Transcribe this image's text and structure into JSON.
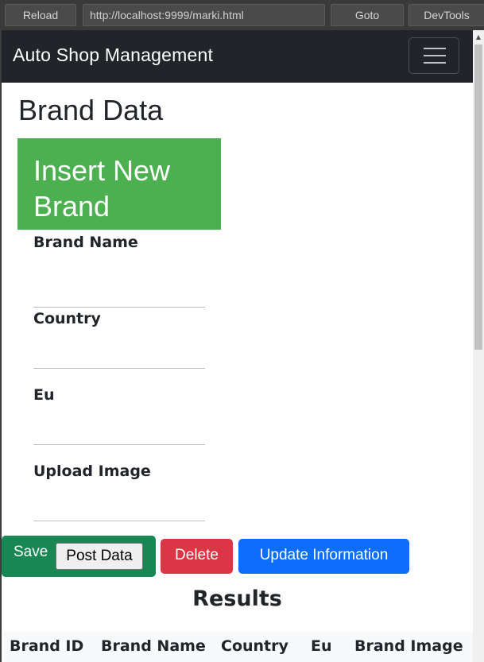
{
  "browser": {
    "reload_label": "Reload",
    "url": "http://localhost:9999/marki.html",
    "goto_label": "Goto",
    "devtools_label": "DevTools"
  },
  "navbar": {
    "brand": "Auto Shop Management"
  },
  "page": {
    "title": "Brand Data"
  },
  "form": {
    "heading": "Insert New Brand",
    "fields": [
      {
        "label": "Brand Name",
        "value": ""
      },
      {
        "label": "Country",
        "value": ""
      },
      {
        "label": "Eu",
        "value": ""
      },
      {
        "label": "Upload Image",
        "value": ""
      }
    ]
  },
  "actions": {
    "save_label": "Save",
    "post_data_label": "Post Data",
    "delete_label": "Delete",
    "update_label": "Update Information"
  },
  "results": {
    "heading": "Results",
    "columns": [
      "Brand ID",
      "Brand Name",
      "Country",
      "Eu",
      "Brand Image"
    ]
  },
  "colors": {
    "navbar_bg": "#212529",
    "card_green": "#4caf50",
    "save_green": "#198754",
    "delete_red": "#dc3545",
    "update_blue": "#0d6efd"
  }
}
